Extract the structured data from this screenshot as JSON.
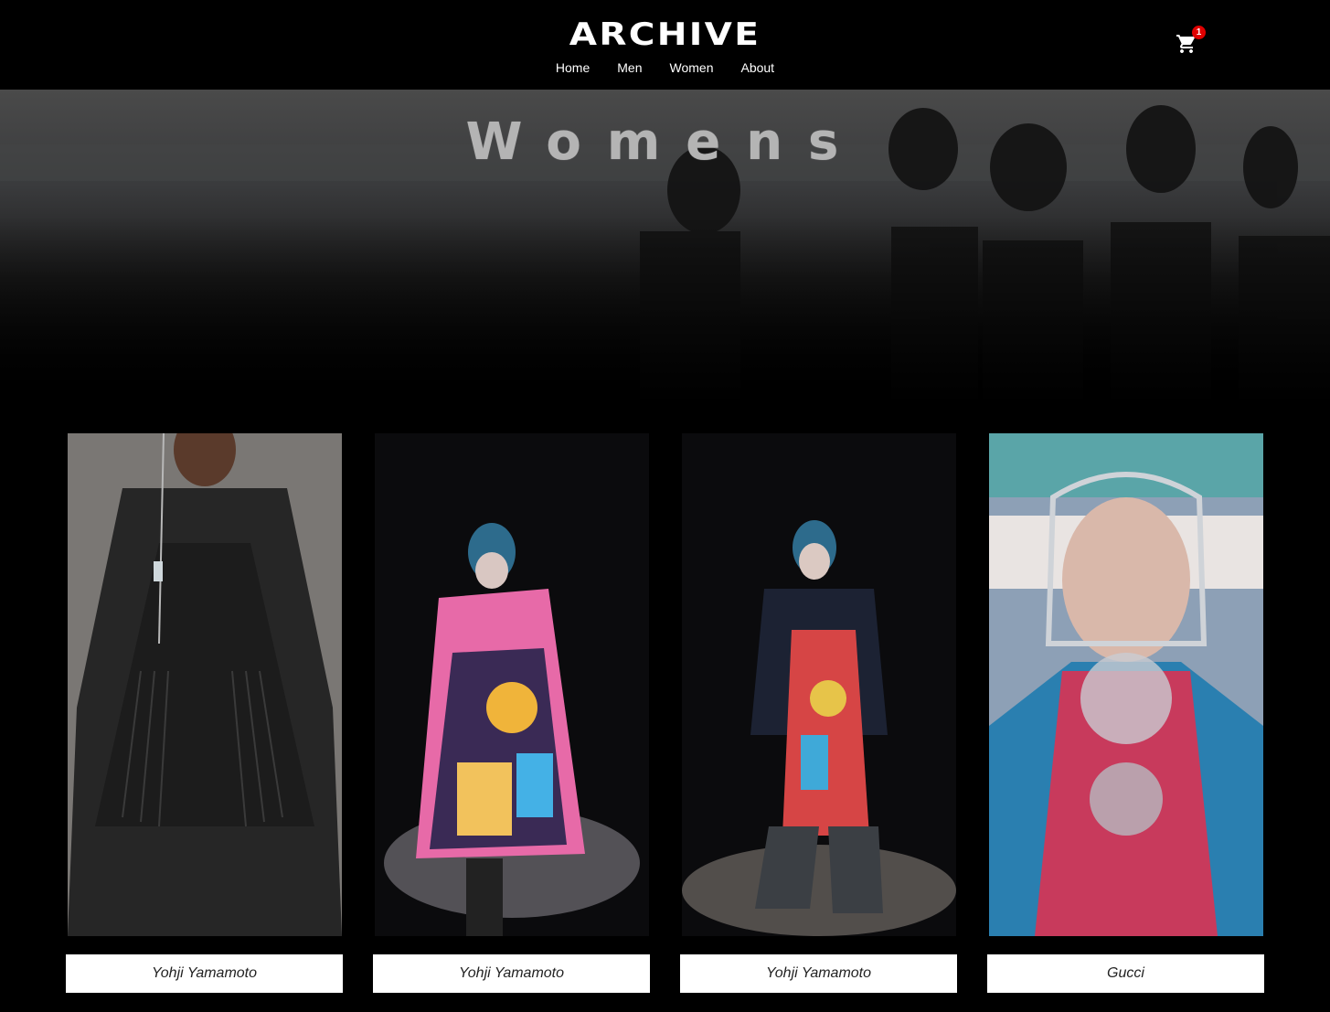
{
  "header": {
    "brand": "ARCHIVE",
    "nav": [
      "Home",
      "Men",
      "Women",
      "About"
    ],
    "cart_count": "1"
  },
  "hero": {
    "title": "Womens"
  },
  "products": [
    {
      "designer": "Yohji Yamamoto",
      "icon": "photo-black-pleated-coat"
    },
    {
      "designer": "Yohji Yamamoto",
      "icon": "photo-graphic-print-coat"
    },
    {
      "designer": "Yohji Yamamoto",
      "icon": "photo-graphic-overalls"
    },
    {
      "designer": "Gucci",
      "icon": "photo-crystal-headpiece"
    }
  ],
  "colors": {
    "background": "#000000",
    "badge": "#e00000",
    "caption_bg": "#ffffff"
  }
}
